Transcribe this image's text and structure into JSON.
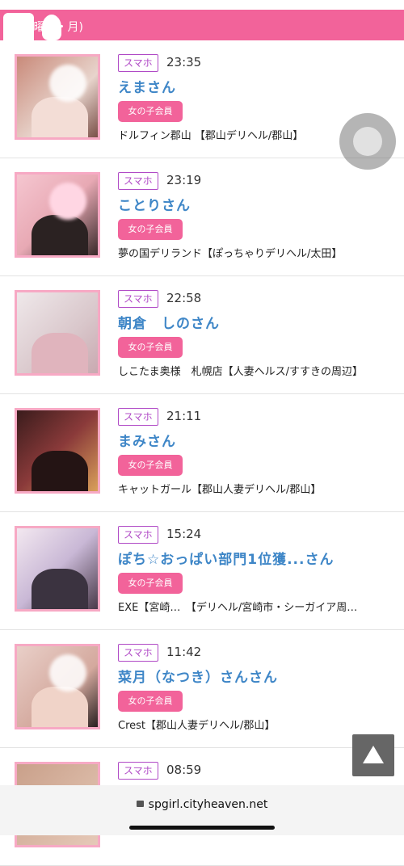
{
  "header": {
    "text": "(土曜日・月)"
  },
  "items": [
    {
      "badge": "スマホ",
      "time": "23:35",
      "name": "えまさん",
      "member": "女の子会員",
      "shop": "ドルフィン郡山 【郡山デリヘル/郡山】"
    },
    {
      "badge": "スマホ",
      "time": "23:19",
      "name": "ことりさん",
      "member": "女の子会員",
      "shop": "夢の国デリランド【ぽっちゃりデリヘル/太田】"
    },
    {
      "badge": "スマホ",
      "time": "22:58",
      "name": "朝倉　しのさん",
      "member": "女の子会員",
      "shop": "しこたま奥様　札幌店【人妻ヘルス/すすきの周辺】"
    },
    {
      "badge": "スマホ",
      "time": "21:11",
      "name": "まみさん",
      "member": "女の子会員",
      "shop": "キャットガール【郡山人妻デリヘル/郡山】"
    },
    {
      "badge": "スマホ",
      "time": "15:24",
      "name": "ぽち☆おっぱい部門1位獲...さん",
      "member": "女の子会員",
      "shop": "EXE【宮崎…　【デリヘル/宮崎市・シーガイア周…"
    },
    {
      "badge": "スマホ",
      "time": "11:42",
      "name": "菜月（なつき）さんさん",
      "member": "女の子会員",
      "shop": "Crest【郡山人妻デリヘル/郡山】"
    },
    {
      "badge": "スマホ",
      "time": "08:59",
      "name": "",
      "member": "",
      "shop": ""
    }
  ],
  "colors": {
    "accent": "#f2639a",
    "name": "#3e86c7",
    "badge": "#b04ac6"
  },
  "url_bar": {
    "url": "spgirl.cityheaven.net"
  },
  "icons": {
    "scroll_top": "triangle-up-icon",
    "lock": "lock-icon",
    "assistive": "assistive-touch-icon"
  }
}
